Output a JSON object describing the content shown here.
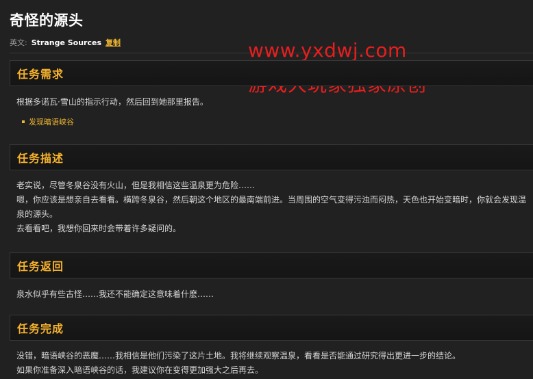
{
  "quest": {
    "title": "奇怪的源头",
    "english_label": "英文:",
    "english_name": "Strange Sources",
    "copy_label": "复制"
  },
  "watermark": {
    "line1": "www.yxdwj.com",
    "line2": "游戏大玩家独家原创"
  },
  "sections": {
    "requirements": {
      "heading": "任务需求",
      "text": "根据多诺瓦·雪山的指示行动，然后回到她那里报告。",
      "objective": "发现暗语峡谷"
    },
    "description": {
      "heading": "任务描述",
      "line1": "老实说，尽管冬泉谷没有火山，但是我相信这些温泉更为危险……",
      "line2": "嗯，你应该是想亲自去看看。横跨冬泉谷，然后朝这个地区的最南端前进。当周围的空气变得污浊而闷热，天色也开始变暗时，你就会发现温泉的源头。",
      "line3": "去看看吧，我想你回来时会带着许多疑问的。"
    },
    "return": {
      "heading": "任务返回",
      "text": "泉水似乎有些古怪……我还不能确定这意味着什麽……"
    },
    "completion": {
      "heading": "任务完成",
      "line1": "没错，暗语峡谷的恶魔……我相信是他们污染了这片土地。我将继续观察温泉，看看是否能通过研究得出更进一步的结论。",
      "line2": "如果你准备深入暗语峡谷的话，我建议你在变得更加强大之后再去。"
    }
  }
}
